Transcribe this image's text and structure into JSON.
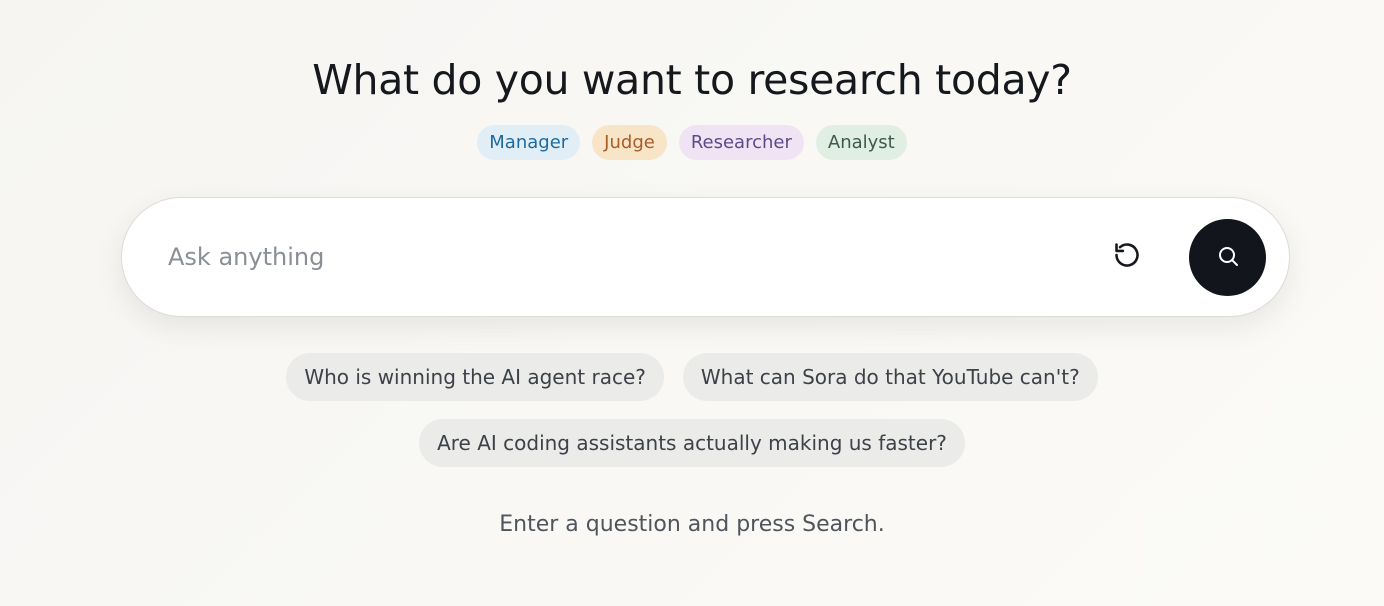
{
  "header": {
    "title": "What do you want to research today?"
  },
  "roles": [
    {
      "label": "Manager",
      "color": "#1e6aa0"
    },
    {
      "label": "Judge",
      "color": "#a75d2b"
    },
    {
      "label": "Researcher",
      "color": "#5c4a8a"
    },
    {
      "label": "Analyst",
      "color": "#3c5a4b"
    }
  ],
  "search": {
    "value": "",
    "placeholder": "Ask anything",
    "reset_icon": "reset-icon",
    "submit_icon": "search-icon",
    "submit_button_color": "#12161c"
  },
  "suggestions": [
    "Who is winning the AI agent race?",
    "What can Sora do that YouTube can't?",
    "Are AI coding assistants actually making us faster?"
  ],
  "status": {
    "hint": "Enter a question and press Search."
  }
}
